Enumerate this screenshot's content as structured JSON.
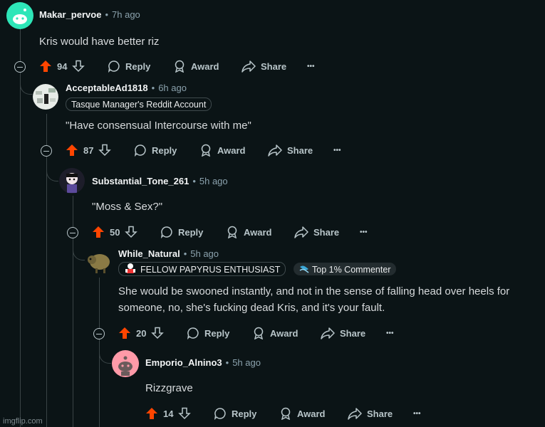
{
  "comments": [
    {
      "username": "Makar_pervoe",
      "time": "7h ago",
      "text": "Kris would have better riz",
      "score": "94",
      "flairs": []
    },
    {
      "username": "AcceptableAd1818",
      "time": "6h ago",
      "text": "\"Have consensual Intercourse with me\"",
      "score": "87",
      "flairs": [
        "Tasque Manager's Reddit Account"
      ]
    },
    {
      "username": "Substantial_Tone_261",
      "time": "5h ago",
      "text": "\"Moss & Sex?\"",
      "score": "50",
      "flairs": []
    },
    {
      "username": "While_Natural",
      "time": "5h ago",
      "text_lines": [
        "She would be swooned instantly, and not in the sense of falling head over heels for",
        "someone, no, she's fucking dead Kris, and it's your fault."
      ],
      "score": "20",
      "flairs": [
        "FELLOW PAPYRUS ENTHUSIAST",
        "Top 1% Commenter"
      ]
    },
    {
      "username": "Emporio_Alnino3",
      "time": "5h ago",
      "text": "Rizzgrave",
      "score": "14",
      "flairs": []
    }
  ],
  "actions": {
    "reply": "Reply",
    "award": "Award",
    "share": "Share",
    "more": "•••"
  },
  "watermark": "imgflip.com",
  "colors": {
    "background": "#0b1416",
    "upvote": "#ff4500",
    "text": "#d7dadc",
    "muted": "#8ba2ad"
  }
}
